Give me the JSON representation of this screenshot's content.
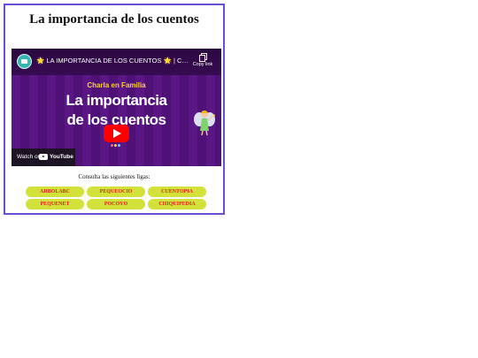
{
  "page": {
    "title": "La importancia de los cuentos"
  },
  "video": {
    "title": "🌟 LA IMPORTANCIA DE LOS CUENTOS 🌟 | Charla en Familia",
    "copy_link_label": "Copy link",
    "slide_kicker": "Charla en Familia",
    "slide_line1": "La importancia",
    "slide_line2": "de los cuentos",
    "watch_on_label": "Watch on",
    "youtube_label": "YouTube",
    "icons": {
      "channel": "channel-logo-icon",
      "copy": "copy-icon",
      "play": "play-icon",
      "youtube": "youtube-icon",
      "fairy": "fairy-illustration-icon"
    },
    "colors": {
      "background": "#4a0f6b",
      "kicker": "#ffcf2e",
      "play": "#ff0000"
    }
  },
  "links_section": {
    "intro": "Consulta las siguientes ligas:",
    "links": [
      "ARBOLABC",
      "PEQUEOCIO",
      "CUENTOPIA",
      "PEQUENET",
      "POCOYO",
      "CHIQUIPEDIA"
    ],
    "colors": {
      "button_bg": "#d3e23a",
      "button_text": "#e0201a"
    }
  },
  "card": {
    "border_color": "#6a4fd6"
  }
}
